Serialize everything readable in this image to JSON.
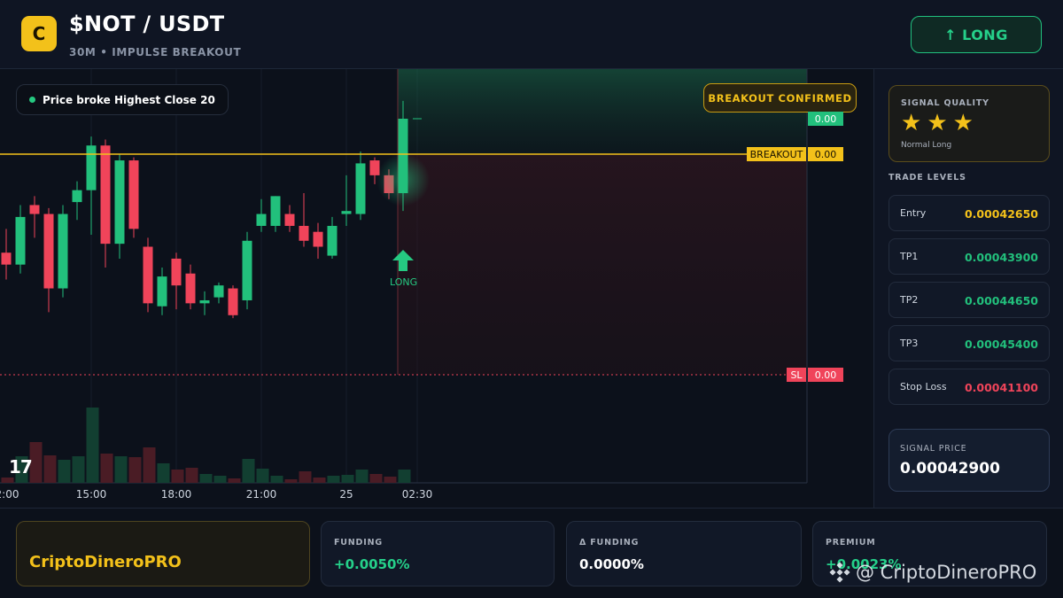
{
  "header": {
    "logo_letter": "C",
    "pair": "$NOT / USDT",
    "subtitle": "30M • IMPULSE BREAKOUT",
    "action_label": "LONG",
    "action_arrow": "↑"
  },
  "chart": {
    "tooltip": "Price broke Highest Close 20",
    "confirmed": "BREAKOUT CONFIRMED",
    "breakout_line_label": "BREAKOUT",
    "breakout_value": "0.00",
    "top_value": "0.00",
    "sl_label": "SL",
    "sl_value": "0.00",
    "long_marker_label": "LONG",
    "tv_logo": "17",
    "x_labels": [
      "2:00",
      "15:00",
      "18:00",
      "21:00",
      "25",
      "02:30"
    ],
    "colors": {
      "up": "#22c07c",
      "down": "#f0445a",
      "breakout": "#f3c11a"
    }
  },
  "chart_data": {
    "type": "candlestick",
    "series": [
      {
        "name": "price",
        "values": [
          {
            "o": 0.55,
            "c": 0.51,
            "h": 0.63,
            "l": 0.46
          },
          {
            "o": 0.51,
            "c": 0.67,
            "h": 0.71,
            "l": 0.48
          },
          {
            "o": 0.71,
            "c": 0.68,
            "h": 0.74,
            "l": 0.6
          },
          {
            "o": 0.68,
            "c": 0.43,
            "h": 0.7,
            "l": 0.35
          },
          {
            "o": 0.43,
            "c": 0.68,
            "h": 0.71,
            "l": 0.4
          },
          {
            "o": 0.72,
            "c": 0.76,
            "h": 0.79,
            "l": 0.66
          },
          {
            "o": 0.76,
            "c": 0.91,
            "h": 0.94,
            "l": 0.61
          },
          {
            "o": 0.91,
            "c": 0.58,
            "h": 0.93,
            "l": 0.5
          },
          {
            "o": 0.58,
            "c": 0.86,
            "h": 0.88,
            "l": 0.53
          },
          {
            "o": 0.86,
            "c": 0.63,
            "h": 0.87,
            "l": 0.6
          },
          {
            "o": 0.57,
            "c": 0.38,
            "h": 0.6,
            "l": 0.35
          },
          {
            "o": 0.37,
            "c": 0.47,
            "h": 0.5,
            "l": 0.34
          },
          {
            "o": 0.53,
            "c": 0.44,
            "h": 0.55,
            "l": 0.36
          },
          {
            "o": 0.48,
            "c": 0.38,
            "h": 0.51,
            "l": 0.36
          },
          {
            "o": 0.38,
            "c": 0.39,
            "h": 0.42,
            "l": 0.34
          },
          {
            "o": 0.4,
            "c": 0.44,
            "h": 0.45,
            "l": 0.38
          },
          {
            "o": 0.43,
            "c": 0.34,
            "h": 0.44,
            "l": 0.33
          },
          {
            "o": 0.39,
            "c": 0.59,
            "h": 0.62,
            "l": 0.36
          },
          {
            "o": 0.64,
            "c": 0.68,
            "h": 0.73,
            "l": 0.62
          },
          {
            "o": 0.64,
            "c": 0.74,
            "h": 0.74,
            "l": 0.62
          },
          {
            "o": 0.68,
            "c": 0.64,
            "h": 0.71,
            "l": 0.62
          },
          {
            "o": 0.64,
            "c": 0.59,
            "h": 0.75,
            "l": 0.57
          },
          {
            "o": 0.62,
            "c": 0.57,
            "h": 0.65,
            "l": 0.53
          },
          {
            "o": 0.54,
            "c": 0.64,
            "h": 0.67,
            "l": 0.53
          },
          {
            "o": 0.68,
            "c": 0.69,
            "h": 0.81,
            "l": 0.64
          },
          {
            "o": 0.68,
            "c": 0.85,
            "h": 0.89,
            "l": 0.66
          },
          {
            "o": 0.86,
            "c": 0.81,
            "h": 0.87,
            "l": 0.78
          },
          {
            "o": 0.81,
            "c": 0.75,
            "h": 0.83,
            "l": 0.73
          },
          {
            "o": 0.75,
            "c": 1.0,
            "h": 1.06,
            "l": 0.69
          }
        ]
      }
    ],
    "volume": [
      0.06,
      0.3,
      0.46,
      0.31,
      0.26,
      0.3,
      0.85,
      0.33,
      0.3,
      0.29,
      0.4,
      0.22,
      0.15,
      0.17,
      0.1,
      0.08,
      0.05,
      0.27,
      0.16,
      0.08,
      0.04,
      0.13,
      0.06,
      0.08,
      0.09,
      0.15,
      0.1,
      0.07,
      0.15
    ],
    "breakout_level": 0.85,
    "stop_level": 0.14
  },
  "signal": {
    "quality_title": "SIGNAL QUALITY",
    "quality_stars": 3,
    "quality_sub": "Normal Long",
    "levels_title": "TRADE LEVELS",
    "levels": [
      {
        "name": "Entry",
        "value": "0.00042650",
        "color": "#f3c11a"
      },
      {
        "name": "TP1",
        "value": "0.00043900",
        "color": "#22c07c"
      },
      {
        "name": "TP2",
        "value": "0.00044650",
        "color": "#22c07c"
      },
      {
        "name": "TP3",
        "value": "0.00045400",
        "color": "#22c07c"
      },
      {
        "name": "Stop Loss",
        "value": "0.00041100",
        "color": "#f0445a"
      }
    ],
    "price_title": "SIGNAL PRICE",
    "price_value": "0.00042900"
  },
  "footer": {
    "brand": "CriptoDineroPRO",
    "stats": [
      {
        "title": "FUNDING",
        "value": "+0.0050%",
        "color": "#25d08a"
      },
      {
        "title": "Δ FUNDING",
        "value": "0.0000%",
        "color": "#ffffff"
      },
      {
        "title": "PREMIUM",
        "value": "+0.0023%",
        "color": "#25d08a"
      }
    ],
    "watermark": "@ CriptoDineroPRO"
  }
}
